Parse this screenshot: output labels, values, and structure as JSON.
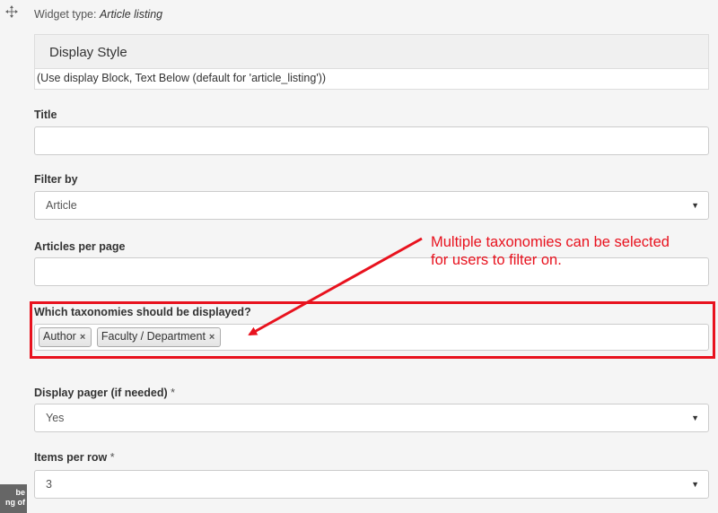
{
  "widget": {
    "type_prefix": "Widget type: ",
    "type_name": "Article listing"
  },
  "display_style": {
    "title": "Display Style",
    "description": "(Use display Block, Text Below (default for 'article_listing'))"
  },
  "fields": {
    "title": {
      "label": "Title",
      "value": ""
    },
    "filter_by": {
      "label": "Filter by",
      "value": "Article"
    },
    "articles_per_page": {
      "label": "Articles per page",
      "value": ""
    },
    "taxonomies": {
      "label": "Which taxonomies should be displayed?",
      "tags": [
        "Author",
        "Faculty / Department"
      ],
      "remove_glyph": "×"
    },
    "display_pager": {
      "label": "Display pager (if needed)",
      "required_mark": "*",
      "value": "Yes"
    },
    "items_per_row": {
      "label": "Items per row",
      "required_mark": "*",
      "value": "3"
    }
  },
  "annotation": {
    "line1": "Multiple taxonomies can be selected",
    "line2": "for users to filter on.",
    "color": "#e8121e"
  },
  "sidebar_tooltip": {
    "line1": "be",
    "line2": "ng of"
  },
  "icons": {
    "drag": "move-handle-icon",
    "select_arrow": "caret-down-icon"
  }
}
